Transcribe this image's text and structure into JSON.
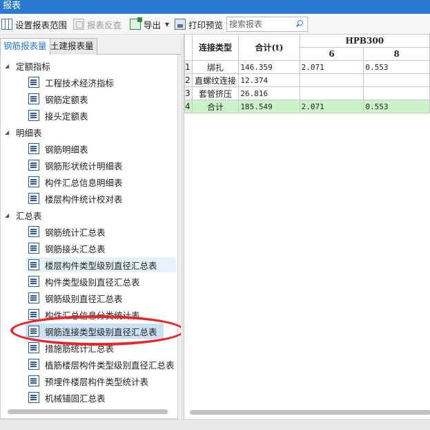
{
  "window": {
    "title": "报表"
  },
  "toolbar": {
    "set_range": "设置报表范围",
    "report_check": "报表反查",
    "export": "导出",
    "print_preview": "打印预览"
  },
  "search": {
    "placeholder": "搜索报表",
    "value": ""
  },
  "tabs": [
    {
      "label": "钢筋报表量",
      "active": true
    },
    {
      "label": "土建报表量",
      "active": false
    }
  ],
  "tree": {
    "groups": [
      {
        "label": "定额指标",
        "items": [
          "工程技术经济指标",
          "钢筋定额表",
          "接头定额表"
        ]
      },
      {
        "label": "明细表",
        "items": [
          "钢筋明细表",
          "钢筋形状统计明细表",
          "构件汇总信息明细表",
          "楼层构件统计校对表"
        ]
      },
      {
        "label": "汇总表",
        "items": [
          "钢筋统计汇总表",
          "钢筋接头汇总表",
          "楼层构件类型级别直径汇总表",
          "构件类型级别直径汇总表",
          "钢筋级别直径汇总表",
          "构件汇总信息分类统计表",
          "钢筋连接类型级别直径汇总表",
          "措施筋统计汇总表",
          "植筋楼层构件类型级别直径汇总表",
          "预埋件楼层构件类型统计表",
          "机械锚固汇总表"
        ]
      }
    ],
    "hovered_item": "楼层构件类型级别直径汇总表",
    "selected_item": "钢筋连接类型级别直径汇总表"
  },
  "grid": {
    "headers": {
      "type": "连接类型",
      "total": "合计(t)",
      "group": "HPB300",
      "sub": [
        "6",
        "8"
      ]
    },
    "rows": [
      {
        "num": "1",
        "type": "绑扎",
        "total": "146.359",
        "c6": "2.071",
        "c8": "0.553"
      },
      {
        "num": "2",
        "type": "直螺纹连接",
        "total": "12.374",
        "c6": "",
        "c8": ""
      },
      {
        "num": "3",
        "type": "套管挤压",
        "total": "26.816",
        "c6": "",
        "c8": ""
      },
      {
        "num": "4",
        "type": "合计",
        "total": "185.549",
        "c6": "2.071",
        "c8": "0.553"
      }
    ]
  },
  "colors": {
    "titlebar": "#2b78d0",
    "total_row": "#ccf2cc",
    "selection": "#cce0f5",
    "annotation": "#e8262b"
  },
  "icons": {
    "set_range": "table-range-icon",
    "report_check": "report-check-icon",
    "export": "excel-export-icon",
    "print_preview": "print-preview-icon",
    "search": "search-icon",
    "tree_item": "document-list-icon",
    "group_toggle": "expanded-triangle-icon"
  }
}
